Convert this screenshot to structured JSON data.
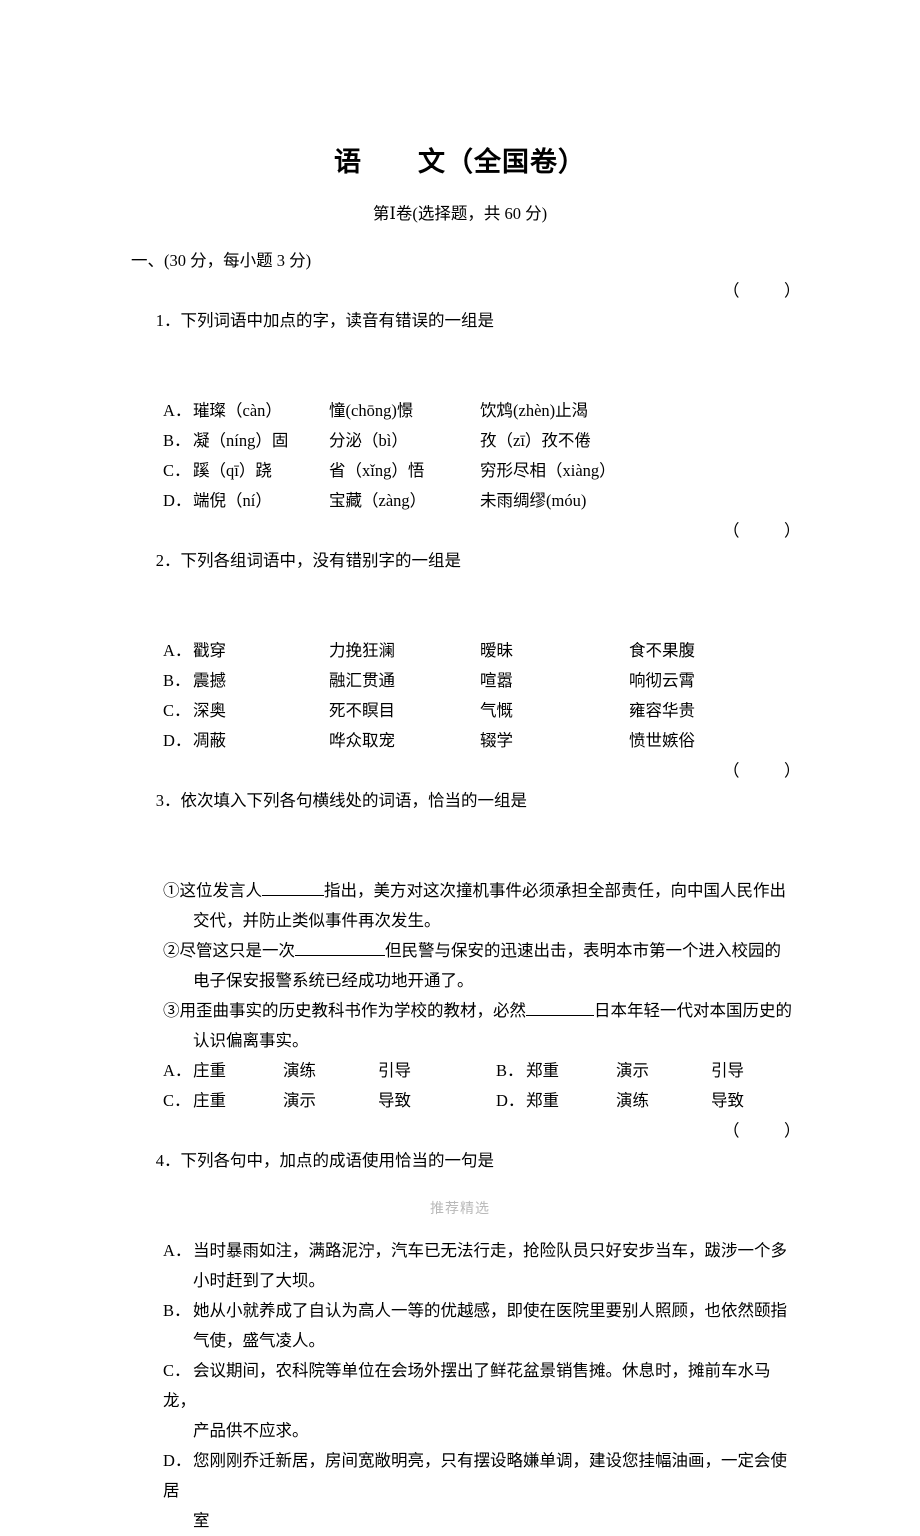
{
  "document": {
    "title": "语　　文（全国卷）",
    "subtitle": "第Ⅰ卷(选择题，共 60 分)",
    "section_header": "一、(30 分，每小题 3 分)",
    "answer_bracket": "（　）",
    "footer_watermark": "推荐精选"
  },
  "questions": [
    {
      "number": "1．",
      "stem": "下列词语中加点的字，读音有错误的一组是",
      "layout": "four-column",
      "options": [
        {
          "label": "A．",
          "cells": [
            "璀璨（càn）",
            "憧(chōng)憬",
            "饮鸩(zhèn)止渴",
            ""
          ]
        },
        {
          "label": "B．",
          "cells": [
            "凝（níng）固",
            "分泌（bì）",
            "孜（zī）孜不倦",
            ""
          ]
        },
        {
          "label": "C．",
          "cells": [
            "蹊（qī）跷",
            "省（xǐng）悟",
            "穷形尽相（xiàng）",
            ""
          ]
        },
        {
          "label": "D．",
          "cells": [
            "端倪（ní）",
            "宝藏（zàng）",
            "未雨绸缪(móu)",
            ""
          ]
        }
      ]
    },
    {
      "number": "2．",
      "stem": "下列各组词语中，没有错别字的一组是",
      "layout": "four-column",
      "options": [
        {
          "label": "A．",
          "cells": [
            "戳穿",
            "力挽狂澜",
            "暧昧",
            "食不果腹"
          ]
        },
        {
          "label": "B．",
          "cells": [
            "震撼",
            "融汇贯通",
            "喧嚣",
            "响彻云霄"
          ]
        },
        {
          "label": "C．",
          "cells": [
            "深奥",
            "死不瞑目",
            "气慨",
            "雍容华贵"
          ]
        },
        {
          "label": "D．",
          "cells": [
            "凋蔽",
            "哗众取宠",
            "辍学",
            "愤世嫉俗"
          ]
        }
      ]
    },
    {
      "number": "3．",
      "stem": "依次填入下列各句横线处的词语，恰当的一组是",
      "layout": "fill-in",
      "sentences": [
        {
          "marker": "①",
          "before": "这位发言人",
          "after": "指出，美方对这次撞机事件必须承担全部责任，向中国人民作出",
          "continuation": "交代，并防止类似事件再次发生。"
        },
        {
          "marker": "②",
          "before": "尽管这只是一次",
          "after": "但民警与保安的迅速出击，表明本市第一个进入校园的",
          "continuation": "电子保安报警系统已经成功地开通了。"
        },
        {
          "marker": "③",
          "before": "用歪曲事实的历史教科书作为学校的教材，必然",
          "after": "日本年轻一代对本国历史的",
          "continuation": "认识偏离事实。"
        }
      ],
      "choice_rows": [
        {
          "left_label": "A．",
          "left_cells": [
            "庄重",
            "演练",
            "引导"
          ],
          "right_label": "B．",
          "right_cells": [
            "郑重",
            "演示",
            "引导"
          ]
        },
        {
          "left_label": "C．",
          "left_cells": [
            "庄重",
            "演示",
            "导致"
          ],
          "right_label": "D．",
          "right_cells": [
            "郑重",
            "演练",
            "导致"
          ]
        }
      ]
    },
    {
      "number": "4．",
      "stem": "下列各句中，加点的成语使用恰当的一句是",
      "layout": "paragraph",
      "options": [
        {
          "label": "A．",
          "line1": "当时暴雨如注，满路泥泞，汽车已无法行走，抢险队员只好安步当车，跋涉一个多",
          "line2": "小时赶到了大坝。"
        },
        {
          "label": "B．",
          "line1": "她从小就养成了自认为高人一等的优越感，即使在医院里要别人照顾，也依然颐指",
          "line2": "气使，盛气凌人。"
        },
        {
          "label": "C．",
          "line1": "会议期间，农科院等单位在会场外摆出了鲜花盆景销售摊。休息时，摊前车水马龙，",
          "line2": "产品供不应求。"
        },
        {
          "label": "D．",
          "line1": "您刚刚乔迁新居，房间宽敞明亮，只有摆设略嫌单调，建设您挂幅油画，一定会使居",
          "line2": "室"
        }
      ]
    }
  ]
}
